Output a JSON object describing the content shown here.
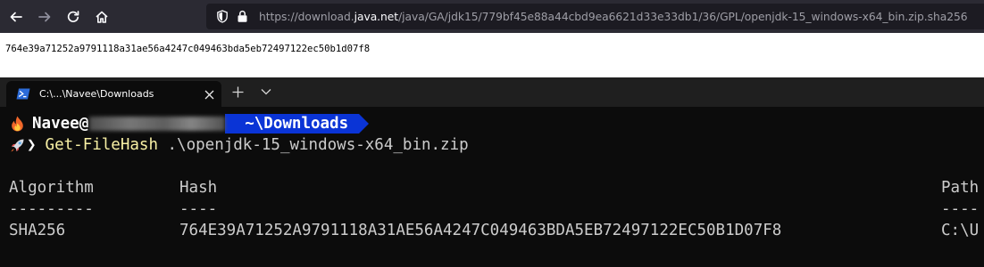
{
  "browser": {
    "back_icon": "back-arrow-icon",
    "forward_icon": "forward-arrow-icon",
    "reload_icon": "reload-icon",
    "home_icon": "home-icon",
    "url_prefix": "https://download.",
    "url_domain": "java.net",
    "url_path": "/java/GA/jdk15/779bf45e88a44cbd9ea6621d33e33db1/36/GPL/openjdk-15_windows-x64_bin.zip.sha256"
  },
  "page": {
    "hash_text": "764e39a71252a9791118a31ae56a4247c049463bda5eb72497122ec50b1d07f8"
  },
  "terminal": {
    "tab_title": "C:\\...\\Navee\\Downloads",
    "prompt": {
      "user": "Navee",
      "at": "@",
      "directory": "~\\Downloads",
      "chevron": "❯"
    },
    "command": {
      "cmdlet": "Get-FileHash",
      "argument": " .\\openjdk-15_windows-x64_bin.zip"
    },
    "table": {
      "headers": [
        "Algorithm",
        "Hash",
        "Path"
      ],
      "dashes": [
        "---------",
        "----",
        "----"
      ],
      "rows": [
        [
          "SHA256",
          "764E39A71252A9791118A31AE56A4247C049463BDA5EB72497122EC50B1D07F8",
          "C:\\U"
        ]
      ]
    },
    "colors": {
      "background": "#0c0c0c",
      "cmdlet": "#f9f1a5",
      "dir_segment": "#0a34d6"
    }
  }
}
